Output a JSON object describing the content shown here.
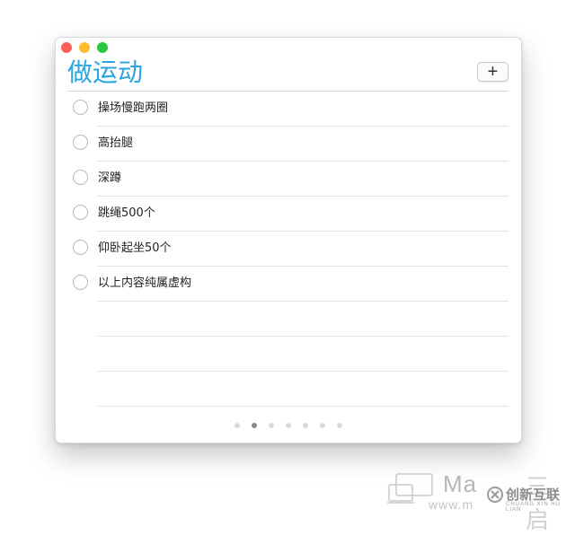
{
  "colors": {
    "accent": "#2aa5e0",
    "close": "#fe5f57",
    "minimize": "#febc2e",
    "zoom": "#28c840"
  },
  "window": {
    "title": "做运动",
    "add_label": "+"
  },
  "tasks": [
    {
      "label": "操场慢跑两圈",
      "done": false
    },
    {
      "label": "高抬腿",
      "done": false
    },
    {
      "label": "深蹲",
      "done": false
    },
    {
      "label": "跳绳500个",
      "done": false
    },
    {
      "label": "仰卧起坐50个",
      "done": false
    },
    {
      "label": "以上内容纯属虚构",
      "done": false
    }
  ],
  "pagination": {
    "total": 7,
    "current": 2
  },
  "watermark": {
    "text": "Ma",
    "text_right": "三 启",
    "url": "www.m",
    "brand": "创新互联",
    "brand_sub": "CHUANG XIN HU LIAN"
  }
}
